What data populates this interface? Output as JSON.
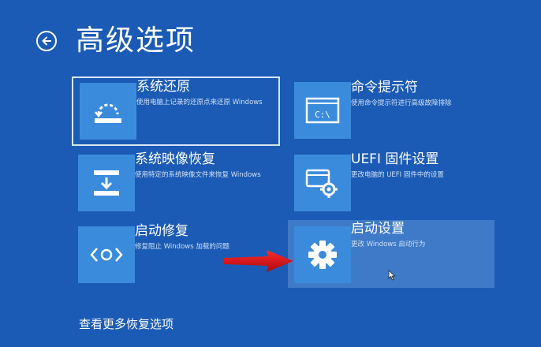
{
  "header": {
    "title": "高级选项",
    "back_icon": "back-arrow-icon"
  },
  "options": [
    {
      "id": "system-restore",
      "title": "系统还原",
      "description": "使用电脑上记录的还原点来还原 Windows",
      "icon": "system-restore-icon",
      "state": "focused"
    },
    {
      "id": "command-prompt",
      "title": "命令提示符",
      "description": "使用命令提示符进行高级故障排除",
      "icon": "command-prompt-icon",
      "state": "normal"
    },
    {
      "id": "system-image-recovery",
      "title": "系统映像恢复",
      "description": "使用特定的系统映像文件来恢复 Windows",
      "icon": "system-image-icon",
      "state": "normal"
    },
    {
      "id": "uefi-settings",
      "title": "UEFI 固件设置",
      "description": "更改电脑的 UEFI 固件中的设置",
      "icon": "uefi-firmware-icon",
      "state": "normal"
    },
    {
      "id": "startup-repair",
      "title": "启动修复",
      "description": "修复阻止 Windows 加载的问题",
      "icon": "startup-repair-icon",
      "state": "normal"
    },
    {
      "id": "startup-settings",
      "title": "启动设置",
      "description": "更改 Windows 启动行为",
      "icon": "gear-icon",
      "state": "hover"
    }
  ],
  "footer": {
    "more_options": "查看更多恢复选项"
  },
  "colors": {
    "background": "#1b5bb5",
    "tile_icon": "#3a8bdc",
    "hover_tile": "#3f7ac9",
    "annotation_arrow": "#d1121b"
  }
}
